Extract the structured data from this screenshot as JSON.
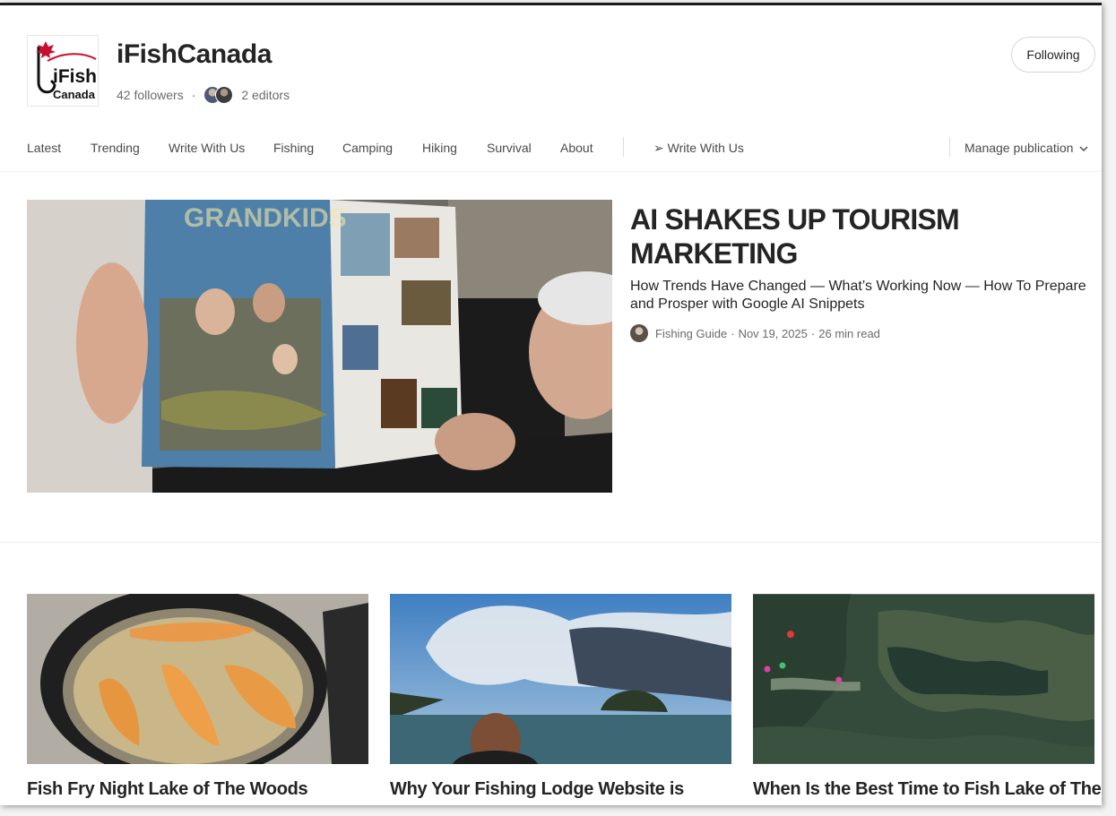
{
  "publication": {
    "logo": {
      "word": "iFish",
      "sub": "Canada"
    },
    "name": "iFishCanada",
    "followers": "42 followers",
    "separator": "·",
    "editors": "2 editors",
    "follow_button": "Following"
  },
  "nav": {
    "items": [
      {
        "label": "Latest"
      },
      {
        "label": "Trending"
      },
      {
        "label": "Write With Us"
      },
      {
        "label": "Fishing"
      },
      {
        "label": "Camping"
      },
      {
        "label": "Hiking"
      },
      {
        "label": "Survival"
      },
      {
        "label": "About"
      }
    ],
    "extra_link": "➢ Write With Us",
    "manage": "Manage publication"
  },
  "featured": {
    "title": "AI SHAKES UP TOURISM MARKETING",
    "subtitle": "How Trends Have Changed — What’s Working Now — How To Prepare and Prosper with Google AI Snippets",
    "author": "Fishing Guide",
    "date": "Nov 19, 2025",
    "read_time": "26 min read",
    "meta_sep": "·"
  },
  "cards": [
    {
      "title": "Fish Fry Night Lake of The Woods"
    },
    {
      "title": "Why Your Fishing Lodge Website is"
    },
    {
      "title": "When Is the Best Time to Fish Lake of The"
    }
  ],
  "colors": {
    "text": "#242424",
    "muted": "#6b6b6b",
    "border": "#d6d6d6",
    "logo_red": "#c8102e"
  }
}
